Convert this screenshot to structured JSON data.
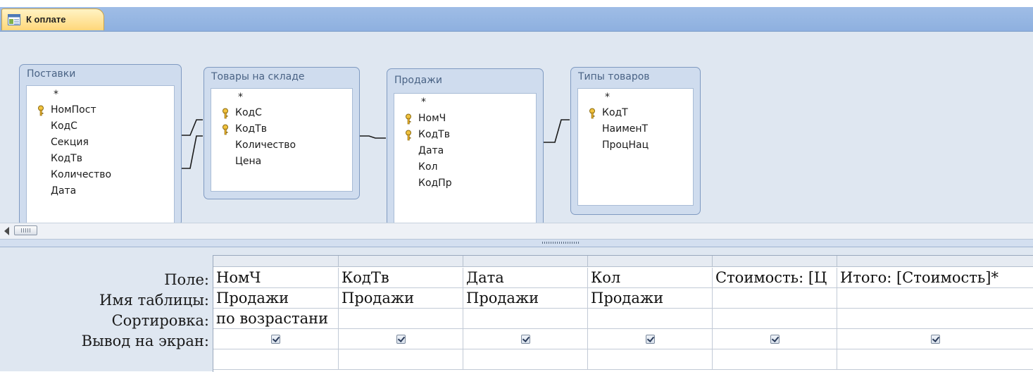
{
  "tab": {
    "label": "К оплате",
    "icon": "query-icon"
  },
  "tables": [
    {
      "id": "postavki",
      "title": "Поставки",
      "fields": [
        "*",
        "НомПост",
        "КодС",
        "Секция",
        "КодТв",
        "Количество",
        "Дата"
      ],
      "keys": [
        "НомПост"
      ]
    },
    {
      "id": "tovary",
      "title": "Товары на складе",
      "fields": [
        "*",
        "КодС",
        "КодТв",
        "Количество",
        "Цена"
      ],
      "keys": [
        "КодС",
        "КодТв"
      ]
    },
    {
      "id": "prodazhi",
      "title": "Продажи",
      "fields": [
        "*",
        "НомЧ",
        "КодТв",
        "Дата",
        "Кол",
        "КодПр"
      ],
      "keys": [
        "НомЧ",
        "КодТв"
      ]
    },
    {
      "id": "tipy",
      "title": "Типы товаров",
      "fields": [
        "*",
        "КодТ",
        "НаименТ",
        "ПроцНац"
      ],
      "keys": [
        "КодТ"
      ]
    }
  ],
  "grid": {
    "row_labels": [
      "Поле:",
      "Имя таблицы:",
      "Сортировка:",
      "Вывод на экран:"
    ],
    "columns": [
      {
        "field": "НомЧ",
        "table": "Продажи",
        "sort": "по возрастани",
        "show": true
      },
      {
        "field": "КодТв",
        "table": "Продажи",
        "sort": "",
        "show": true
      },
      {
        "field": "Дата",
        "table": "Продажи",
        "sort": "",
        "show": true
      },
      {
        "field": "Кол",
        "table": "Продажи",
        "sort": "",
        "show": true
      },
      {
        "field": "Стоимость: [Ц",
        "table": "",
        "sort": "",
        "show": true
      },
      {
        "field": "Итого: [Стоимость]*",
        "table": "",
        "sort": "",
        "show": true
      }
    ]
  },
  "colors": {
    "tab_bg": "#ffd77a",
    "tabbar": "#9fbde6",
    "pane_bg": "#dfe7f1",
    "key": "#c99a1d"
  }
}
